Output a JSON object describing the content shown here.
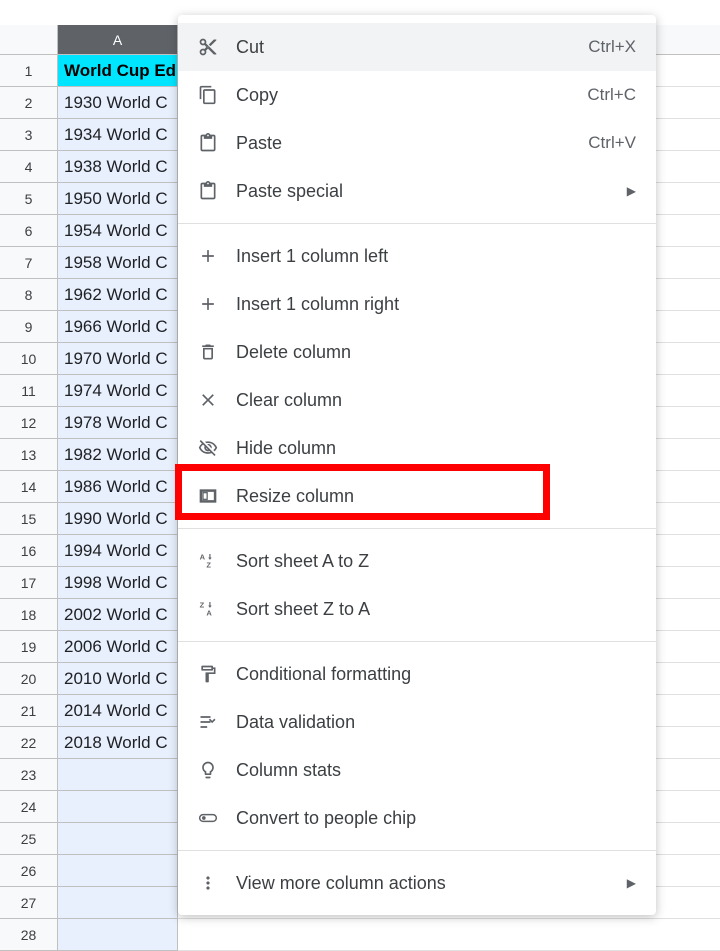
{
  "sheet": {
    "selected_column_label": "A",
    "header_row": {
      "label": "World Cup Ed"
    },
    "rows": [
      "1930 World C",
      "1934 World C",
      "1938 World C",
      "1950 World C",
      "1954 World C",
      "1958 World C",
      "1962 World C",
      "1966 World C",
      "1970 World C",
      "1974 World C",
      "1978 World C",
      "1982 World C",
      "1986 World C",
      "1990 World C",
      "1994 World C",
      "1998 World C",
      "2002 World C",
      "2006 World C",
      "2010 World C",
      "2014 World C",
      "2018 World C"
    ],
    "row_numbers": [
      1,
      2,
      3,
      4,
      5,
      6,
      7,
      8,
      9,
      10,
      11,
      12,
      13,
      14,
      15,
      16,
      17,
      18,
      19,
      20,
      21,
      22,
      23,
      24,
      25,
      26,
      27,
      28
    ]
  },
  "menu": {
    "cut": {
      "label": "Cut",
      "shortcut": "Ctrl+X"
    },
    "copy": {
      "label": "Copy",
      "shortcut": "Ctrl+C"
    },
    "paste": {
      "label": "Paste",
      "shortcut": "Ctrl+V"
    },
    "paste_special": {
      "label": "Paste special"
    },
    "insert_left": {
      "label": "Insert 1 column left"
    },
    "insert_right": {
      "label": "Insert 1 column right"
    },
    "delete_col": {
      "label": "Delete column"
    },
    "clear_col": {
      "label": "Clear column"
    },
    "hide_col": {
      "label": "Hide column"
    },
    "resize_col": {
      "label": "Resize column"
    },
    "sort_az": {
      "label": "Sort sheet A to Z"
    },
    "sort_za": {
      "label": "Sort sheet Z to A"
    },
    "cond_format": {
      "label": "Conditional formatting"
    },
    "data_valid": {
      "label": "Data validation"
    },
    "col_stats": {
      "label": "Column stats"
    },
    "people_chip": {
      "label": "Convert to people chip"
    },
    "more_actions": {
      "label": "View more column actions"
    }
  }
}
